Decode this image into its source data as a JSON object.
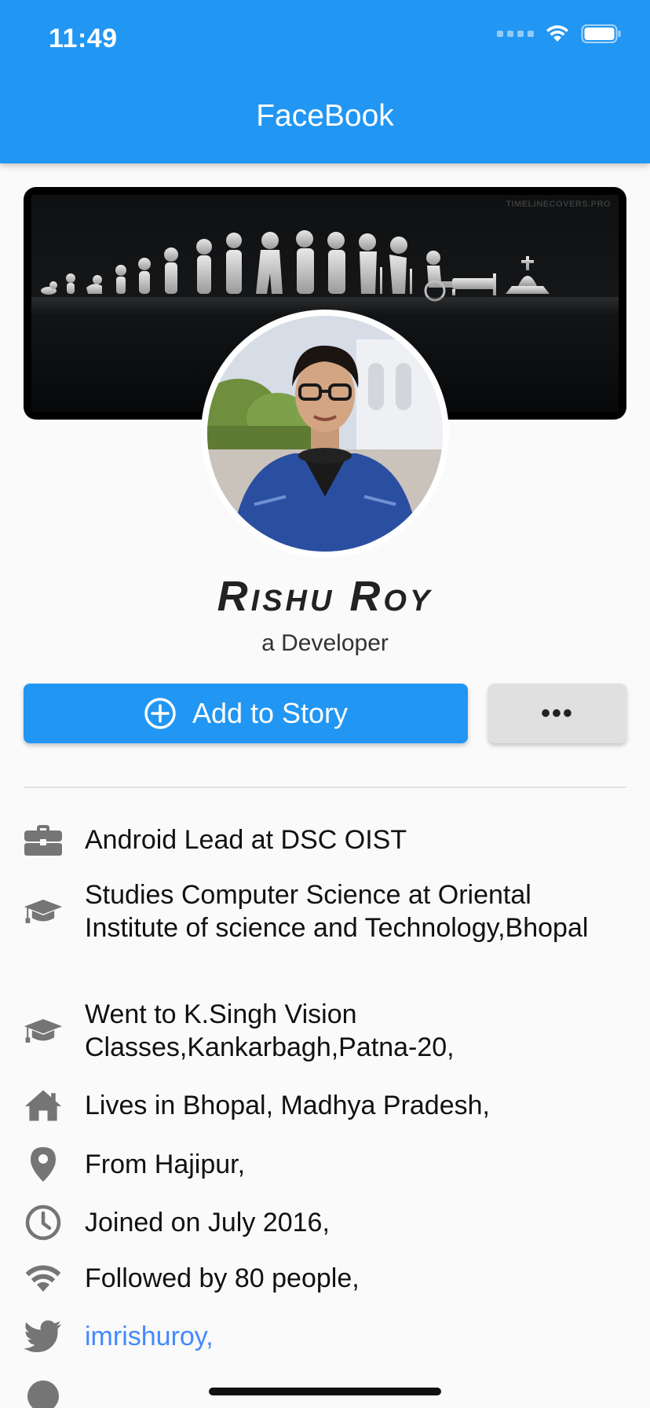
{
  "status_bar": {
    "time": "11:49"
  },
  "appbar": {
    "title": "FaceBook",
    "color": "#2196f3"
  },
  "cover": {
    "watermark": "TIMELINECOVERS.PRO"
  },
  "profile": {
    "name": "Rishu Roy",
    "subtitle": "a Developer"
  },
  "actions": {
    "add_story_label": "Add to Story",
    "more_label": "•••"
  },
  "info": [
    {
      "icon": "briefcase-icon",
      "text": "Android Lead at DSC OIST"
    },
    {
      "icon": "graduation-cap-icon",
      "text": "Studies Computer Science at Oriental Institute of science and Technology,Bhopal"
    },
    {
      "icon": "graduation-cap-icon",
      "text": "Went to K.Singh Vision Classes,Kankarbagh,Patna-20,"
    },
    {
      "icon": "home-icon",
      "text": "Lives in Bhopal, Madhya Pradesh,"
    },
    {
      "icon": "location-pin-icon",
      "text": "From Hajipur,"
    },
    {
      "icon": "clock-icon",
      "text": "Joined on July 2016,"
    },
    {
      "icon": "wifi-icon",
      "text": "Followed by 80 people,"
    },
    {
      "icon": "twitter-icon",
      "text": "imrishuroy,"
    }
  ],
  "colors": {
    "icon_gray": "#757575",
    "link_blue": "#448aff"
  }
}
